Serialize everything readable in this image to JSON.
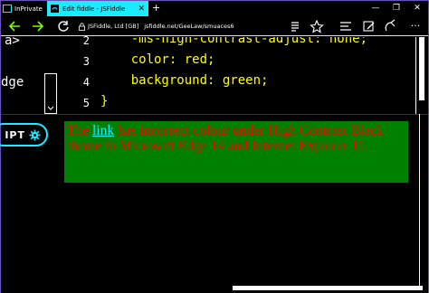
{
  "browser": {
    "inprivate_label": "InPrivate",
    "active_tab_title": "Edit fiddle - JSFiddle",
    "address_org": "JSFiddle, Ltd [GB]",
    "address_url": "jsfiddle.net/GeeLaw/smuaces6",
    "accent_color": "#1aebff"
  },
  "editor": {
    "left_fragments": [
      "a>",
      "dge"
    ],
    "line_numbers": [
      "2",
      "3",
      "4",
      "5"
    ],
    "code_lines": [
      "    -ms-high-contrast-adjust: none;",
      "    color: red;",
      "    background: green;",
      "}"
    ]
  },
  "script_tab": {
    "label": "IPT"
  },
  "result": {
    "text_before": "The ",
    "link_text": "link",
    "text_after": " has incorrect colour under High Contrast Black theme in Microsoft Edge 14 and Internet Explorer 11."
  },
  "icons": [
    "inprivate-icon",
    "jsfiddle-favicon",
    "close-icon",
    "new-tab-icon",
    "minimize-icon",
    "restore-icon",
    "window-close-icon",
    "back-icon",
    "forward-icon",
    "refresh-icon",
    "lock-icon",
    "reading-view-icon",
    "favorite-icon",
    "hub-icon",
    "web-note-icon",
    "share-icon",
    "more-icon",
    "gear-icon",
    "chevron-down-icon"
  ]
}
